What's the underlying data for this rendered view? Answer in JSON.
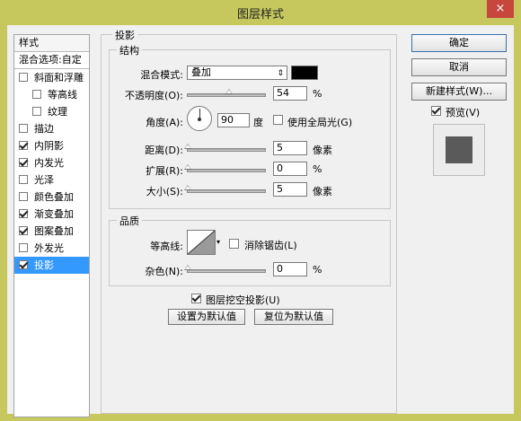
{
  "window": {
    "title": "图层样式",
    "close_label": "×"
  },
  "sidebar": {
    "header": "样式",
    "blend_options": "混合选项:自定",
    "items": [
      {
        "label": "斜面和浮雕",
        "checked": false
      },
      {
        "label": "等高线",
        "checked": false
      },
      {
        "label": "纹理",
        "checked": false
      },
      {
        "label": "描边",
        "checked": false
      },
      {
        "label": "内阴影",
        "checked": true
      },
      {
        "label": "内发光",
        "checked": true
      },
      {
        "label": "光泽",
        "checked": false
      },
      {
        "label": "颜色叠加",
        "checked": false
      },
      {
        "label": "渐变叠加",
        "checked": true
      },
      {
        "label": "图案叠加",
        "checked": true
      },
      {
        "label": "外发光",
        "checked": false
      },
      {
        "label": "投影",
        "checked": true
      }
    ]
  },
  "panel": {
    "section_title": "投影",
    "structure": {
      "title": "结构",
      "blend_mode_label": "混合模式:",
      "blend_mode_value": "叠加",
      "blend_color": "#000000",
      "opacity_label": "不透明度(O):",
      "opacity_value": "54",
      "opacity_unit": "%",
      "opacity_fraction": 0.54,
      "angle_label": "角度(A):",
      "angle_value": "90",
      "angle_unit": "度",
      "global_light_label": "使用全局光(G)",
      "global_light_checked": false,
      "distance_label": "距离(D):",
      "distance_value": "5",
      "distance_unit": "像素",
      "spread_label": "扩展(R):",
      "spread_value": "0",
      "spread_unit": "%",
      "size_label": "大小(S):",
      "size_value": "5",
      "size_unit": "像素"
    },
    "quality": {
      "title": "品质",
      "contour_label": "等高线:",
      "antialias_label": "消除锯齿(L)",
      "antialias_checked": false,
      "noise_label": "杂色(N):",
      "noise_value": "0",
      "noise_unit": "%"
    },
    "knockout_label": "图层挖空投影(U)",
    "knockout_checked": true,
    "make_default_label": "设置为默认值",
    "reset_default_label": "复位为默认值"
  },
  "actions": {
    "ok_label": "确定",
    "cancel_label": "取消",
    "new_style_label": "新建样式(W)...",
    "preview_label": "预览(V)",
    "preview_checked": true
  }
}
